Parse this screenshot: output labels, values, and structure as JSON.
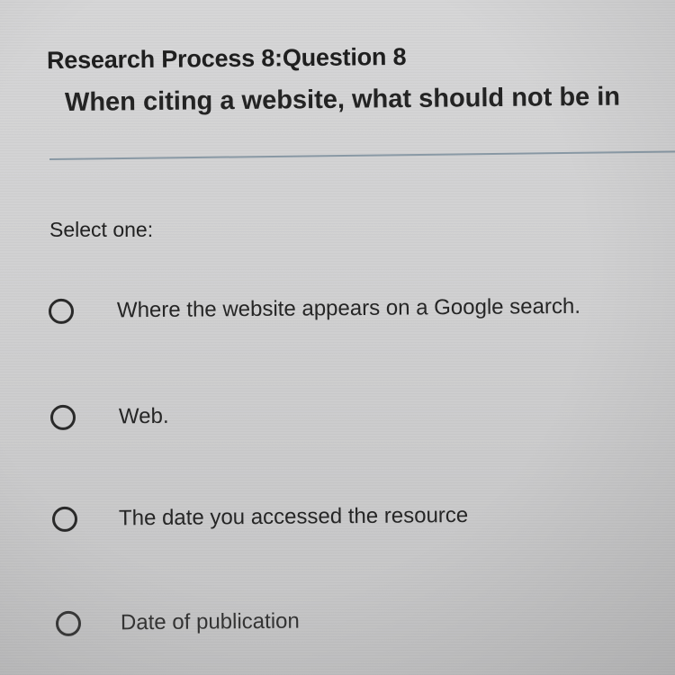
{
  "question": {
    "title": "Research Process 8:Question 8",
    "text": "When citing a website, what should not be in"
  },
  "select_label": "Select one:",
  "options": [
    {
      "label": "Where the website appears on a Google search.",
      "selected": false
    },
    {
      "label": "Web.",
      "selected": false
    },
    {
      "label": "The date you accessed the resource",
      "selected": false
    },
    {
      "label": "Date of publication",
      "selected": false
    }
  ],
  "colors": {
    "background": "#d0d0d1",
    "text": "#1f1f1f",
    "divider": "#8a9aa6"
  }
}
